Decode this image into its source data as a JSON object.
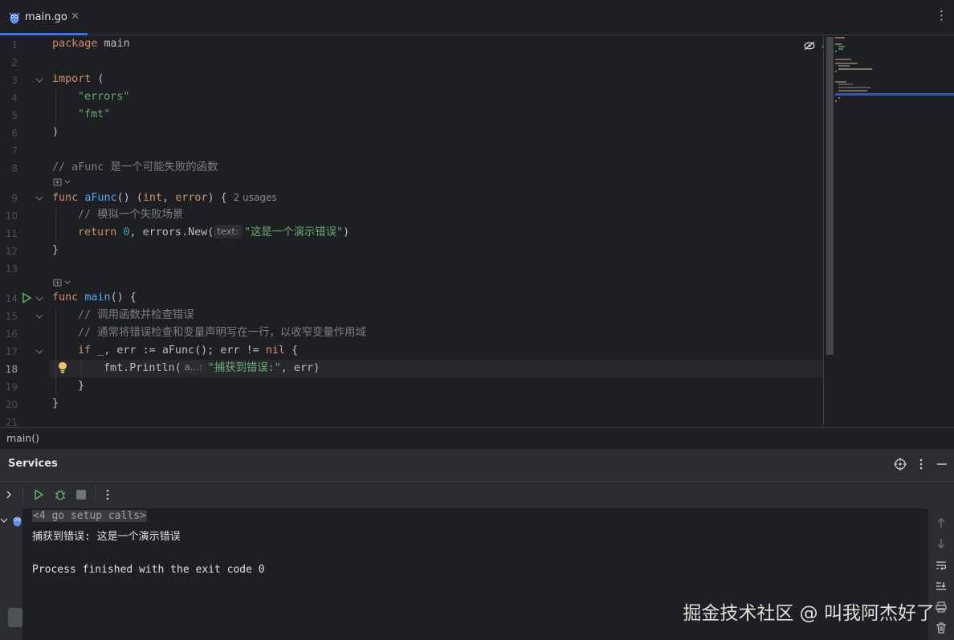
{
  "tab": {
    "file_name": "main.go",
    "close_glyph": "✕",
    "more_glyph": "⋮"
  },
  "code": {
    "lines": [
      {
        "n": "1"
      },
      {
        "n": "2"
      },
      {
        "n": "3"
      },
      {
        "n": "4"
      },
      {
        "n": "5"
      },
      {
        "n": "6"
      },
      {
        "n": "7"
      },
      {
        "n": "8"
      },
      {
        "n": "9"
      },
      {
        "n": "10"
      },
      {
        "n": "11"
      },
      {
        "n": "12"
      },
      {
        "n": "13"
      },
      {
        "n": "14"
      },
      {
        "n": "15"
      },
      {
        "n": "16"
      },
      {
        "n": "17"
      },
      {
        "n": "18"
      },
      {
        "n": "19"
      },
      {
        "n": "20"
      },
      {
        "n": "21"
      }
    ],
    "l1": {
      "kw": "package",
      "rest": " main"
    },
    "l3": {
      "kw": "import",
      "rest": " ("
    },
    "l4": "\"errors\"",
    "l5": "\"fmt\"",
    "l6": ")",
    "l8": "// aFunc 是一个可能失败的函数",
    "l9": {
      "kw": "func",
      "name": "aFunc",
      "p1": "() (",
      "t1": "int",
      "p2": ", ",
      "t2": "error",
      "p3": ") {",
      "usages": "2 usages"
    },
    "l10": "// 模拟一个失败场景",
    "l11": {
      "kw": "return",
      "num": "0",
      "p1": ", errors.",
      "fn": "New",
      "p2": "(",
      "hint": "text:",
      "str": "\"这是一个演示错误\"",
      "p3": ")"
    },
    "l12": "}",
    "l14": {
      "kw": "func",
      "name": "main",
      "rest": "() {"
    },
    "l15": "// 调用函数并检查错误",
    "l16": "// 通常将错误检查和变量声明写在一行，以收窄变量作用域",
    "l17": {
      "kw": "if",
      "p1": " _, err := ",
      "fn": "aFunc",
      "p2": "(); err != ",
      "nil": "nil",
      "p3": " {"
    },
    "l18": {
      "p1": "fmt.",
      "fn": "Println",
      "p2": "(",
      "hint": "a...:",
      "str": "\"捕获到错误:\"",
      "p3": ", err)"
    },
    "l19": "}",
    "l20": "}"
  },
  "breadcrumb": "main()",
  "services": {
    "title": "Services",
    "console": {
      "setup": "<4 go setup calls>",
      "output": "捕获到错误: 这是一个演示错误",
      "exit": "Process finished with the exit code 0"
    }
  },
  "watermark": "掘金技术社区 @ 叫我阿杰好了",
  "colors": {
    "keyword": "#cf8e6d",
    "function": "#56a8f5",
    "string": "#6aab73",
    "number": "#2aacb8",
    "comment": "#7a7e85",
    "accent": "#3574f0",
    "run_green": "#5fb865"
  },
  "icons": [
    "gopher-icon",
    "close-icon",
    "more-icon",
    "eye-off-icon",
    "check-icon",
    "run-gutter-icon",
    "fold-icon",
    "bulb-icon",
    "generate-icon",
    "target-icon",
    "minimize-icon",
    "run-icon",
    "debug-icon",
    "stop-icon",
    "up-arrow-icon",
    "down-arrow-icon",
    "soft-wrap-icon",
    "scroll-end-icon",
    "print-icon",
    "trash-icon"
  ]
}
